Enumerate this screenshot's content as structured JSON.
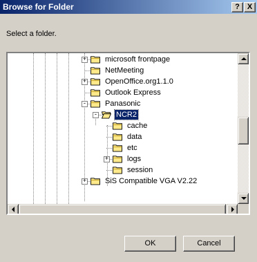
{
  "window": {
    "title": "Browse for Folder",
    "help_label": "?",
    "close_label": "X"
  },
  "prompt": "Select a folder.",
  "tree": {
    "items": [
      {
        "label": "microsoft frontpage",
        "expander": "+",
        "icon": "folder-closed-icon"
      },
      {
        "label": "NetMeeting",
        "expander": "",
        "icon": "folder-closed-icon"
      },
      {
        "label": "OpenOffice.org1.1.0",
        "expander": "+",
        "icon": "folder-closed-icon"
      },
      {
        "label": "Outlook Express",
        "expander": "",
        "icon": "folder-closed-icon"
      },
      {
        "label": "Panasonic",
        "expander": "-",
        "icon": "folder-closed-icon"
      },
      {
        "label": "NCR2",
        "expander": "-",
        "icon": "folder-open-icon",
        "selected": true
      },
      {
        "label": "cache",
        "expander": "",
        "icon": "folder-closed-icon"
      },
      {
        "label": "data",
        "expander": "",
        "icon": "folder-closed-icon"
      },
      {
        "label": "etc",
        "expander": "",
        "icon": "folder-closed-icon"
      },
      {
        "label": "logs",
        "expander": "+",
        "icon": "folder-closed-icon"
      },
      {
        "label": "session",
        "expander": "",
        "icon": "folder-closed-icon"
      },
      {
        "label": "SiS Compatible VGA V2.22",
        "expander": "+",
        "icon": "folder-closed-icon"
      }
    ]
  },
  "buttons": {
    "ok": "OK",
    "cancel": "Cancel"
  },
  "colors": {
    "titlebar_start": "#0a246a",
    "titlebar_end": "#a6caf0",
    "selection": "#0a246a",
    "folder_yellow": "#ffe98a"
  }
}
